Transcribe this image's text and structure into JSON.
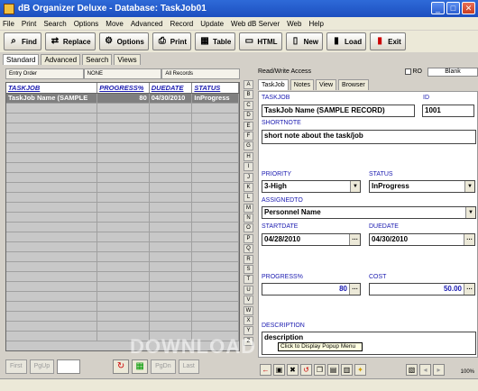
{
  "window": {
    "title": "dB Organizer Deluxe - Database: TaskJob01"
  },
  "menu": [
    "File",
    "Print",
    "Search",
    "Options",
    "Move",
    "Advanced",
    "Record",
    "Update",
    "Web dB Server",
    "Web",
    "Help"
  ],
  "toolbar": {
    "find": "Find",
    "replace": "Replace",
    "options": "Options",
    "print": "Print",
    "table": "Table",
    "html": "HTML",
    "new": "New",
    "load": "Load",
    "exit": "Exit"
  },
  "left_tabs": [
    "Standard",
    "Advanced",
    "Search",
    "Views"
  ],
  "filters": {
    "sort": "Entry Order",
    "filter": "NONE",
    "records": "All Records"
  },
  "grid": {
    "headers": [
      "TASKJOB",
      "PROGRESS%",
      "DUEDATE",
      "STATUS"
    ],
    "rows": [
      {
        "taskjob": "TaskJob Name (SAMPLE",
        "progress": "80",
        "duedate": "04/30/2010",
        "status": "InProgress"
      }
    ]
  },
  "nav": {
    "first": "First",
    "pgup": "PgUp",
    "pgdn": "PgDn",
    "last": "Last"
  },
  "right": {
    "access": "Read/Write Access",
    "ro_label": "RO",
    "blank_label": "Blank",
    "tabs": [
      "TaskJob",
      "Notes",
      "View",
      "Browser"
    ],
    "alphabet": [
      "A",
      "B",
      "C",
      "D",
      "E",
      "F",
      "G",
      "H",
      "I",
      "J",
      "K",
      "L",
      "M",
      "N",
      "O",
      "P",
      "Q",
      "R",
      "S",
      "T",
      "U",
      "V",
      "W",
      "X",
      "Y",
      "Z"
    ]
  },
  "form": {
    "taskjob_label": "TASKJOB",
    "taskjob_value": "TaskJob Name (SAMPLE RECORD)",
    "id_label": "ID",
    "id_value": "1001",
    "shortnote_label": "SHORTNOTE",
    "shortnote_value": "short note about the task/job",
    "priority_label": "PRIORITY",
    "priority_value": "3-High",
    "status_label": "STATUS",
    "status_value": "InProgress",
    "assignedto_label": "ASSIGNEDTO",
    "assignedto_value": "Personnel Name",
    "startdate_label": "STARTDATE",
    "startdate_value": "04/28/2010",
    "duedate_label": "DUEDATE",
    "duedate_value": "04/30/2010",
    "progress_label": "PROGRESS%",
    "progress_value": "80",
    "cost_label": "COST",
    "cost_value": "50.00",
    "description_label": "DESCRIPTION",
    "description_value": "description"
  },
  "tooltip": "Click to Display Popup Menu",
  "zoom": "100%",
  "watermark": "DOWNLOAD",
  "colors": {
    "title_bar": "#2e6ad8",
    "field_label": "#1a1ab0",
    "selected_row": "#7f7f7f"
  }
}
